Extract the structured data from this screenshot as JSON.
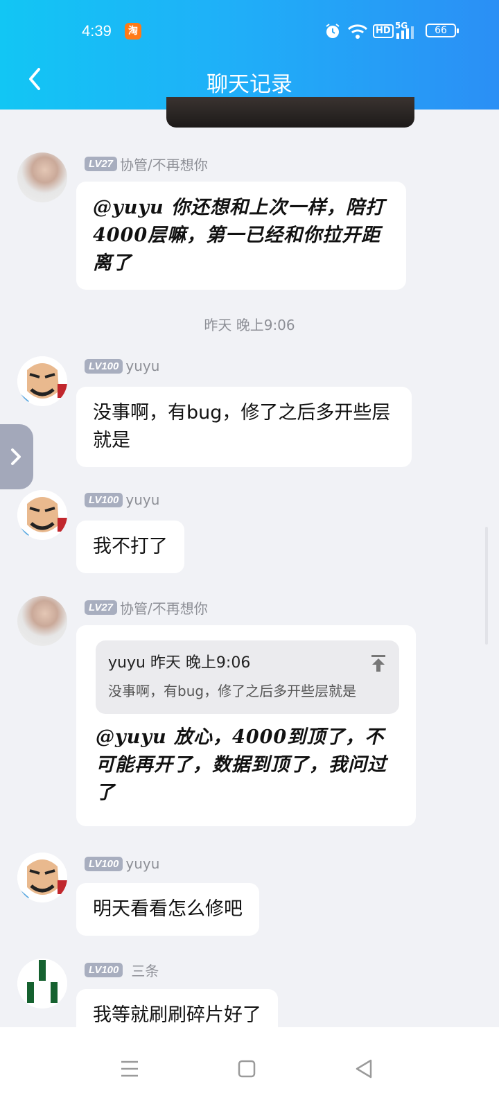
{
  "status_bar": {
    "time": "4:39",
    "taobao_label": "淘",
    "hd_label": "HD",
    "signal_label": "5G",
    "battery": "66"
  },
  "header": {
    "title": "聊天记录"
  },
  "messages": [
    {
      "level": "LV27",
      "nickname": "协管/不再想你",
      "text": "@yuyu 你还想和上次一样，陪打4000层嘛，第一已经和你拉开距离了"
    },
    {
      "time_separator": "昨天 晚上9:06"
    },
    {
      "level": "LV100",
      "nickname": "yuyu",
      "text": "没事啊，有bug，修了之后多开些层就是"
    },
    {
      "level": "LV100",
      "nickname": "yuyu",
      "text": "我不打了"
    },
    {
      "level": "LV27",
      "nickname": "协管/不再想你",
      "quote": {
        "header": "yuyu 昨天 晚上9:06",
        "body": "没事啊，有bug，修了之后多开些层就是"
      },
      "text": "@yuyu 放心，4000到顶了，不可能再开了，数据到顶了，我问过了"
    },
    {
      "level": "LV100",
      "nickname": "yuyu",
      "text": "明天看看怎么修吧"
    },
    {
      "level": "LV100",
      "nickname": "三条",
      "text": "我等就刷刷碎片好了"
    }
  ],
  "colors": {
    "header_gradient_start": "#12c6f4",
    "header_gradient_end": "#2b8ff5",
    "background": "#f1f2f6",
    "level_badge": "#a8aebf"
  }
}
